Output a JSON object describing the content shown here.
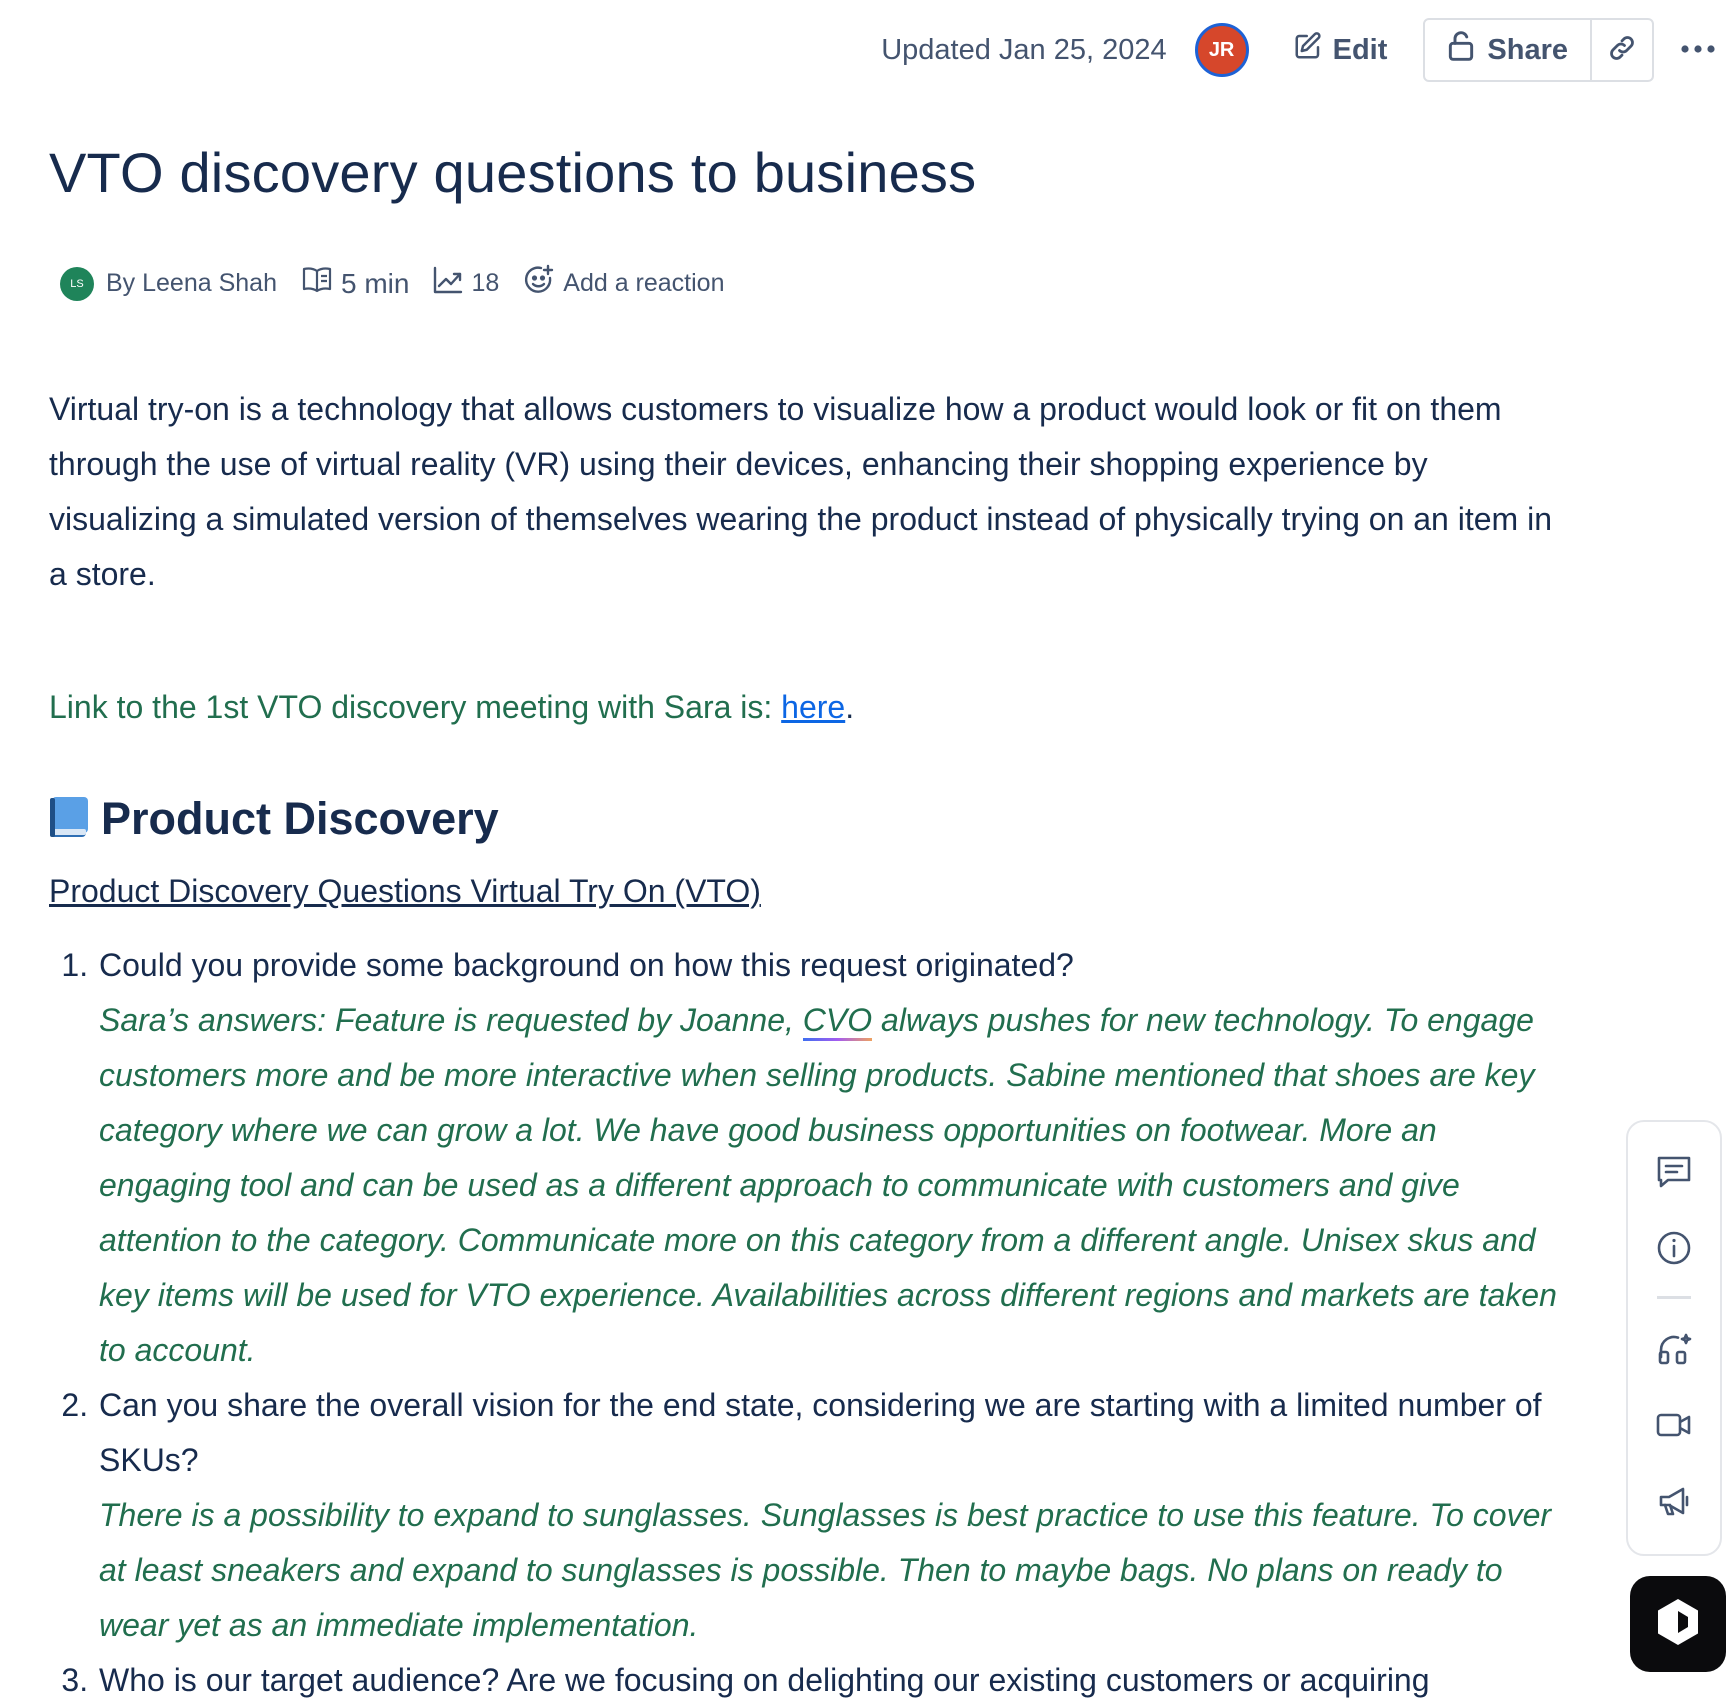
{
  "header": {
    "updated": "Updated Jan 25, 2024",
    "avatar_initials": "JR",
    "edit_label": "Edit",
    "share_label": "Share"
  },
  "title": "VTO discovery questions to business",
  "meta": {
    "author_initials": "LS",
    "author": "By Leena Shah",
    "read_time": "5 min",
    "views": "18",
    "reaction_label": "Add a reaction"
  },
  "intro": "Virtual try-on is a technology that allows customers to visualize how a product would look or fit on them through the use of virtual reality (VR) using their devices, enhancing their shopping experience by visualizing a simulated version of themselves wearing the product instead of physically trying on an item in a store.",
  "meeting_link": {
    "prefix": "Link to the 1st VTO discovery meeting with Sara is: ",
    "link_text": "here",
    "suffix": "."
  },
  "section": {
    "heading": "Product Discovery",
    "subheading": "Product Discovery Questions Virtual Try On (VTO) "
  },
  "questions": [
    {
      "question": "Could you provide some background on how this request originated?",
      "answer_before": "Sara’s answers: Feature is requested by Joanne, ",
      "answer_marked": "CVO",
      "answer_after": " always pushes for new technology. To engage customers more and be more interactive when selling products. Sabine mentioned that shoes are key category where we can grow a lot. We have good business opportunities on footwear. More an engaging tool and can be used as a different approach to communicate with customers and give attention to the category. Communicate more on this category from a different angle. Unisex skus and key items will be used for VTO experience. Availabilities across different regions and markets are taken to account."
    },
    {
      "question": "Can you share the overall vision for the end state, considering we are starting with a limited number of SKUs?",
      "answer": "There is a possibility to expand to sunglasses. Sunglasses is best practice to use this feature. To cover at least sneakers and expand to sunglasses is possible. Then to maybe bags. No plans on ready to wear yet as an immediate implementation."
    },
    {
      "question": "Who is our target audience? Are we focusing on delighting our existing customers or acquiring"
    }
  ],
  "colors": {
    "text": "#172b4d",
    "answer_green": "#216e4e",
    "link_blue": "#0c66e4",
    "avatar_jr": "#d6472b",
    "avatar_ls": "#1f845a"
  }
}
